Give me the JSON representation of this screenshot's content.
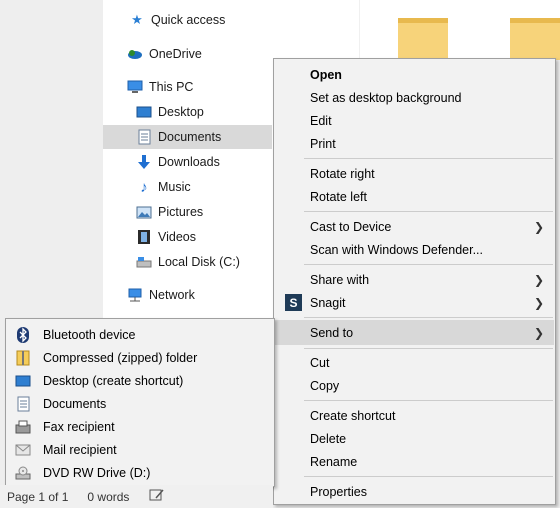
{
  "nav": {
    "items": [
      {
        "label": "Quick access",
        "icon": "star-icon"
      },
      {
        "label": "OneDrive",
        "icon": "cloud-icon"
      },
      {
        "label": "This PC",
        "icon": "computer-icon"
      },
      {
        "label": "Desktop",
        "icon": "desktop-icon"
      },
      {
        "label": "Documents",
        "icon": "document-icon",
        "selected": true
      },
      {
        "label": "Downloads",
        "icon": "download-icon"
      },
      {
        "label": "Music",
        "icon": "music-icon"
      },
      {
        "label": "Pictures",
        "icon": "pictures-icon"
      },
      {
        "label": "Videos",
        "icon": "videos-icon"
      },
      {
        "label": "Local Disk (C:)",
        "icon": "disk-icon"
      },
      {
        "label": "Network",
        "icon": "network-icon"
      }
    ]
  },
  "context_menu": {
    "open": "Open",
    "set_bg": "Set as desktop background",
    "edit": "Edit",
    "print": "Print",
    "rotate_right": "Rotate right",
    "rotate_left": "Rotate left",
    "cast": "Cast to Device",
    "scan": "Scan with Windows Defender...",
    "share": "Share with",
    "snagit": "Snagit",
    "send_to": "Send to",
    "cut": "Cut",
    "copy": "Copy",
    "create_shortcut": "Create shortcut",
    "delete": "Delete",
    "rename": "Rename",
    "properties": "Properties"
  },
  "send_to": {
    "items": [
      {
        "label": "Bluetooth device",
        "icon": "bluetooth-icon"
      },
      {
        "label": "Compressed (zipped) folder",
        "icon": "zip-folder-icon"
      },
      {
        "label": "Desktop (create shortcut)",
        "icon": "desktop-icon"
      },
      {
        "label": "Documents",
        "icon": "document-icon"
      },
      {
        "label": "Fax recipient",
        "icon": "fax-icon"
      },
      {
        "label": "Mail recipient",
        "icon": "mail-icon"
      },
      {
        "label": "DVD RW Drive (D:)",
        "icon": "dvd-drive-icon"
      }
    ]
  },
  "status": {
    "page": "Page 1 of 1",
    "words": "0 words"
  },
  "colors": {
    "hover": "#d8d8d8",
    "selected": "#d9d9d9",
    "folder": "#f7d37a"
  }
}
